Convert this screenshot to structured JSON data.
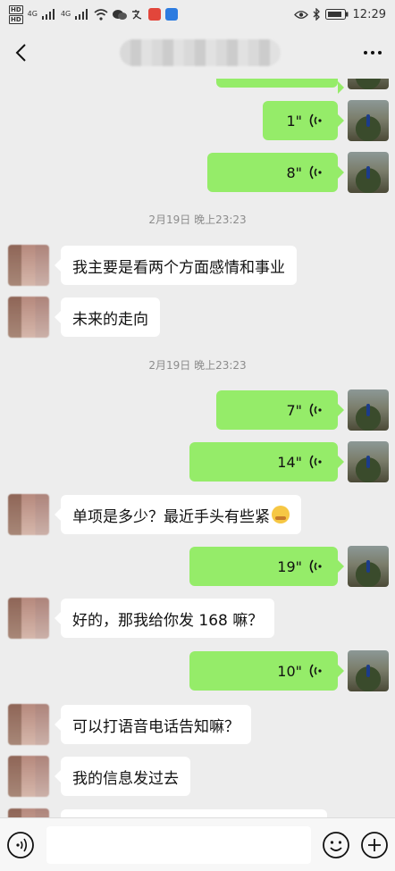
{
  "status_bar": {
    "hd1": "HD",
    "hd2": "HD",
    "net1": "4G",
    "net2": "4G",
    "time": "12:29"
  },
  "messages": [
    {
      "side": "right",
      "kind": "voice",
      "duration": "1\""
    },
    {
      "side": "right",
      "kind": "voice",
      "duration": "8\""
    },
    {
      "kind": "time",
      "text": "2月19日 晚上23:23"
    },
    {
      "side": "left",
      "kind": "text",
      "text": "我主要是看两个方面感情和事业"
    },
    {
      "side": "left",
      "kind": "text",
      "text": "未来的走向"
    },
    {
      "kind": "time",
      "text": "2月19日 晚上23:23"
    },
    {
      "side": "right",
      "kind": "voice",
      "duration": "7\""
    },
    {
      "side": "right",
      "kind": "voice",
      "duration": "14\""
    },
    {
      "side": "left",
      "kind": "text",
      "text": "单项是多少？最近手头有些紧"
    },
    {
      "side": "right",
      "kind": "voice",
      "duration": "19\""
    },
    {
      "side": "left",
      "kind": "text",
      "text": "好的，那我给你发 168 嘛？"
    },
    {
      "side": "right",
      "kind": "voice",
      "duration": "10\""
    },
    {
      "side": "left",
      "kind": "text",
      "text": "可以打语音电话告知嘛？"
    },
    {
      "side": "left",
      "kind": "text",
      "text": "我的信息发过去"
    }
  ],
  "colors": {
    "bubble_green": "#95ec69",
    "bubble_white": "#ffffff",
    "background": "#ededed"
  }
}
